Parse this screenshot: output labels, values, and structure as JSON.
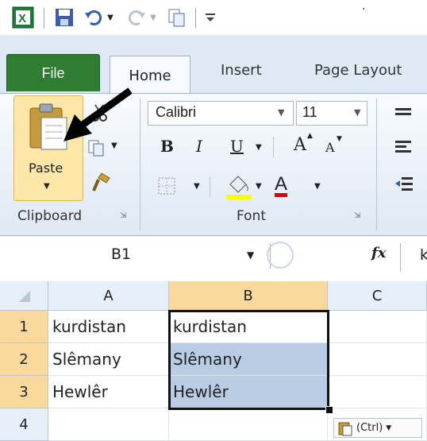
{
  "quick_access": {
    "icons": [
      "excel-logo-icon",
      "save-icon",
      "undo-icon",
      "redo-icon",
      "copy-icon",
      "customize-icon"
    ]
  },
  "tabs": {
    "file": "File",
    "home": "Home",
    "insert": "Insert",
    "page_layout": "Page Layout"
  },
  "clipboard": {
    "paste_label": "Paste",
    "group_label": "Clipboard"
  },
  "font": {
    "name": "Calibri",
    "size": "11",
    "bold": "B",
    "italic": "I",
    "underline": "U",
    "grow": "A",
    "shrink": "A",
    "font_color": "A",
    "group_label": "Font"
  },
  "formula_bar": {
    "name_box": "B1",
    "fx": "fx",
    "content_partial": "k"
  },
  "grid": {
    "columns": [
      "A",
      "B",
      "C"
    ],
    "rows": [
      {
        "num": "1",
        "a": "kurdistan",
        "b": "kurdistan"
      },
      {
        "num": "2",
        "a": "Slêmany",
        "b": "Slêmany"
      },
      {
        "num": "3",
        "a": "Hewlêr",
        "b": "Hewlêr"
      },
      {
        "num": "4",
        "a": "",
        "b": ""
      }
    ],
    "paste_options": "(Ctrl)"
  },
  "colors": {
    "file_tab": "#2e7d32",
    "selection": "#b8cce4",
    "selected_header": "#f9d99b"
  }
}
